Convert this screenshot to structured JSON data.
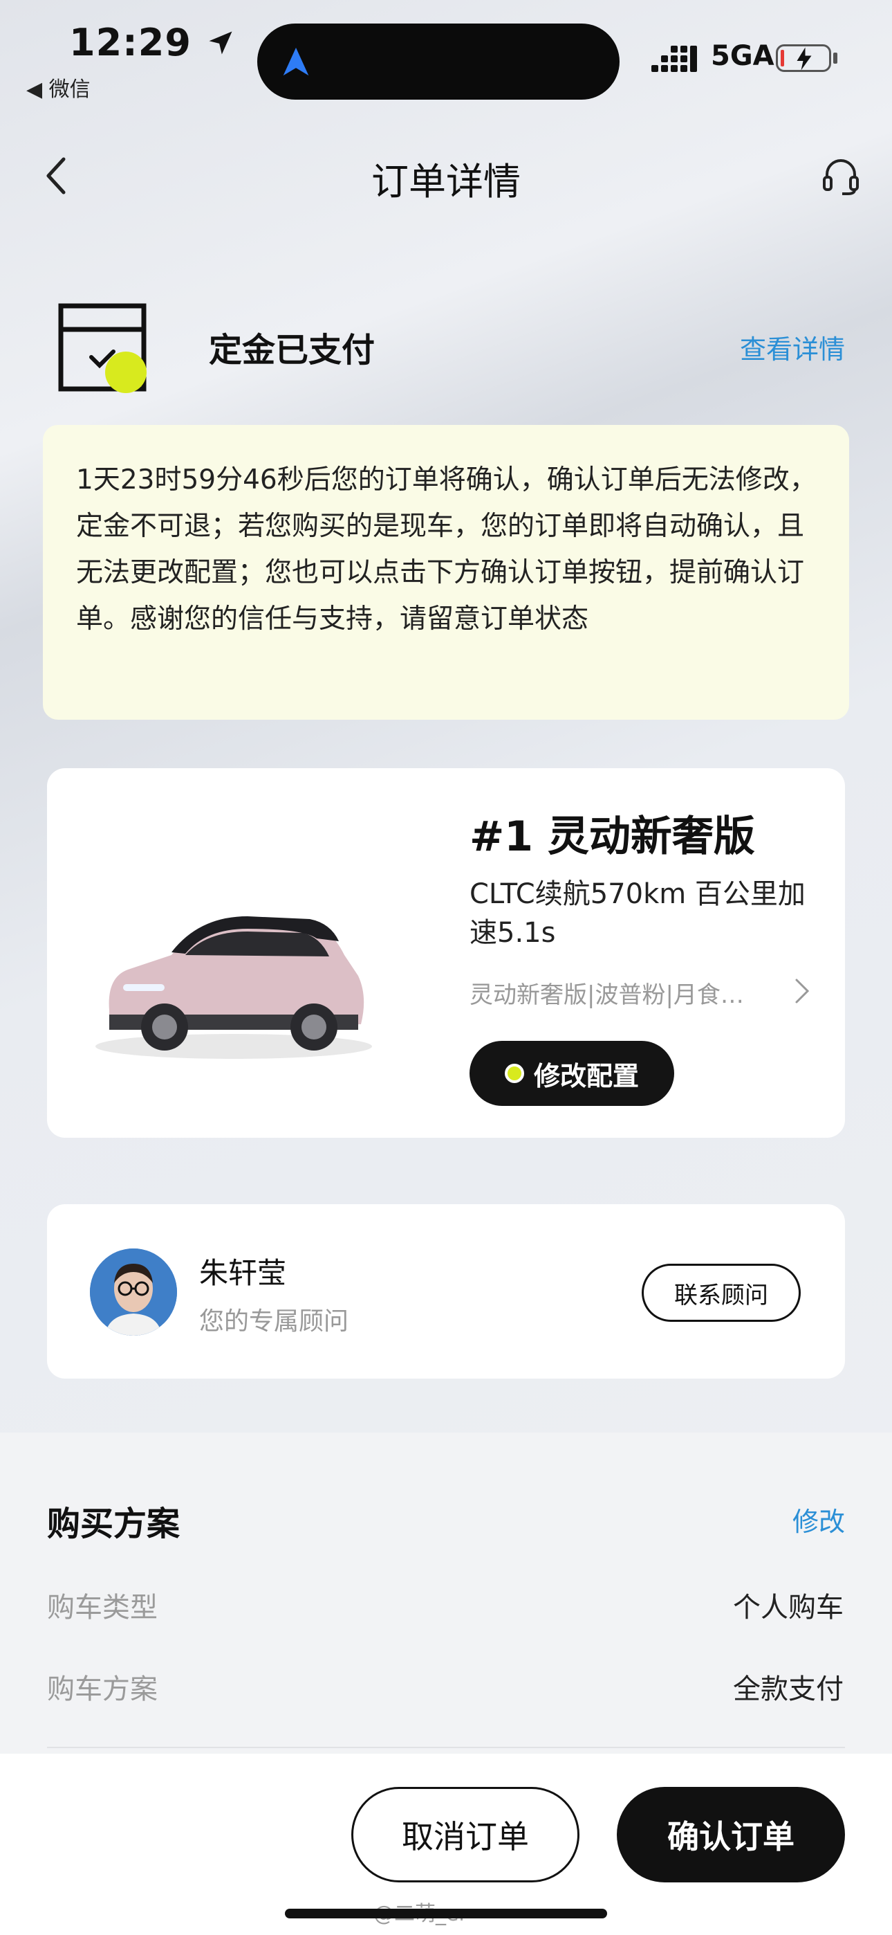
{
  "status_bar": {
    "time": "12:29",
    "back_app": "◀ 微信",
    "network": "5GA"
  },
  "nav": {
    "title": "订单详情"
  },
  "order_status": {
    "title": "定金已支付",
    "link": "查看详情"
  },
  "notice": {
    "text": "1天23时59分46秒后您的订单将确认，确认订单后无法修改，定金不可退；若您购买的是现车，您的订单即将自动确认，且无法更改配置；您也可以点击下方确认订单按钮，提前确认订单。感谢您的信任与支持，请留意订单状态"
  },
  "car": {
    "title": "#1 灵动新奢版",
    "spec": "CLTC续航570km 百公里加速5.1s",
    "config": "灵动新奢版|波普粉|月食…",
    "modify_label": "修改配置"
  },
  "advisor": {
    "name": "朱轩莹",
    "role": "您的专属顾问",
    "contact_label": "联系顾问"
  },
  "purchase": {
    "title": "购买方案",
    "edit_label": "修改",
    "rows": [
      {
        "label": "购车类型",
        "value": "个人购车"
      },
      {
        "label": "购车方案",
        "value": "全款支付"
      }
    ]
  },
  "actions": {
    "cancel_label": "取消订单",
    "confirm_label": "确认订单"
  },
  "watermark": "@二萌_er",
  "colors": {
    "accent_blue": "#2b8fd6",
    "accent_yellow": "#d8ea1e",
    "notice_bg": "#fafbe6",
    "dark": "#111111"
  }
}
